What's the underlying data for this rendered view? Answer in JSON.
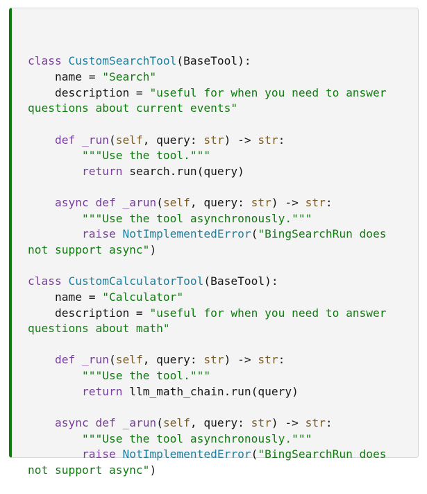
{
  "code": {
    "lines": [
      [
        {
          "t": "kw",
          "v": "class "
        },
        {
          "t": "cls",
          "v": "CustomSearchTool"
        },
        {
          "t": "plain",
          "v": "(BaseTool):"
        }
      ],
      [
        {
          "t": "plain",
          "v": "    name = "
        },
        {
          "t": "str",
          "v": "\"Search\""
        }
      ],
      [
        {
          "t": "plain",
          "v": "    description = "
        },
        {
          "t": "str",
          "v": "\"useful for when you need to answer"
        }
      ],
      [
        {
          "t": "str",
          "v": "questions about current events\""
        }
      ],
      [],
      [
        {
          "t": "plain",
          "v": "    "
        },
        {
          "t": "kw",
          "v": "def "
        },
        {
          "t": "fn",
          "v": "_run"
        },
        {
          "t": "plain",
          "v": "("
        },
        {
          "t": "bi",
          "v": "self"
        },
        {
          "t": "plain",
          "v": ", query: "
        },
        {
          "t": "bi",
          "v": "str"
        },
        {
          "t": "plain",
          "v": ") -> "
        },
        {
          "t": "bi",
          "v": "str"
        },
        {
          "t": "plain",
          "v": ":"
        }
      ],
      [
        {
          "t": "plain",
          "v": "        "
        },
        {
          "t": "str",
          "v": "\"\"\"Use the tool.\"\"\""
        }
      ],
      [
        {
          "t": "plain",
          "v": "        "
        },
        {
          "t": "kw",
          "v": "return "
        },
        {
          "t": "plain",
          "v": "search.run(query)"
        }
      ],
      [],
      [
        {
          "t": "plain",
          "v": "    "
        },
        {
          "t": "kw",
          "v": "async def "
        },
        {
          "t": "fn",
          "v": "_arun"
        },
        {
          "t": "plain",
          "v": "("
        },
        {
          "t": "bi",
          "v": "self"
        },
        {
          "t": "plain",
          "v": ", query: "
        },
        {
          "t": "bi",
          "v": "str"
        },
        {
          "t": "plain",
          "v": ") -> "
        },
        {
          "t": "bi",
          "v": "str"
        },
        {
          "t": "plain",
          "v": ":"
        }
      ],
      [
        {
          "t": "plain",
          "v": "        "
        },
        {
          "t": "str",
          "v": "\"\"\"Use the tool asynchronously.\"\"\""
        }
      ],
      [
        {
          "t": "plain",
          "v": "        "
        },
        {
          "t": "kw",
          "v": "raise "
        },
        {
          "t": "cls",
          "v": "NotImplementedError"
        },
        {
          "t": "plain",
          "v": "("
        },
        {
          "t": "str",
          "v": "\"BingSearchRun does"
        }
      ],
      [
        {
          "t": "str",
          "v": "not support async\""
        },
        {
          "t": "plain",
          "v": ")"
        }
      ],
      [],
      [
        {
          "t": "kw",
          "v": "class "
        },
        {
          "t": "cls",
          "v": "CustomCalculatorTool"
        },
        {
          "t": "plain",
          "v": "(BaseTool):"
        }
      ],
      [
        {
          "t": "plain",
          "v": "    name = "
        },
        {
          "t": "str",
          "v": "\"Calculator\""
        }
      ],
      [
        {
          "t": "plain",
          "v": "    description = "
        },
        {
          "t": "str",
          "v": "\"useful for when you need to answer"
        }
      ],
      [
        {
          "t": "str",
          "v": "questions about math\""
        }
      ],
      [],
      [
        {
          "t": "plain",
          "v": "    "
        },
        {
          "t": "kw",
          "v": "def "
        },
        {
          "t": "fn",
          "v": "_run"
        },
        {
          "t": "plain",
          "v": "("
        },
        {
          "t": "bi",
          "v": "self"
        },
        {
          "t": "plain",
          "v": ", query: "
        },
        {
          "t": "bi",
          "v": "str"
        },
        {
          "t": "plain",
          "v": ") -> "
        },
        {
          "t": "bi",
          "v": "str"
        },
        {
          "t": "plain",
          "v": ":"
        }
      ],
      [
        {
          "t": "plain",
          "v": "        "
        },
        {
          "t": "str",
          "v": "\"\"\"Use the tool.\"\"\""
        }
      ],
      [
        {
          "t": "plain",
          "v": "        "
        },
        {
          "t": "kw",
          "v": "return "
        },
        {
          "t": "plain",
          "v": "llm_math_chain.run(query)"
        }
      ],
      [],
      [
        {
          "t": "plain",
          "v": "    "
        },
        {
          "t": "kw",
          "v": "async def "
        },
        {
          "t": "fn",
          "v": "_arun"
        },
        {
          "t": "plain",
          "v": "("
        },
        {
          "t": "bi",
          "v": "self"
        },
        {
          "t": "plain",
          "v": ", query: "
        },
        {
          "t": "bi",
          "v": "str"
        },
        {
          "t": "plain",
          "v": ") -> "
        },
        {
          "t": "bi",
          "v": "str"
        },
        {
          "t": "plain",
          "v": ":"
        }
      ],
      [
        {
          "t": "plain",
          "v": "        "
        },
        {
          "t": "str",
          "v": "\"\"\"Use the tool asynchronously.\"\"\""
        }
      ],
      [
        {
          "t": "plain",
          "v": "        "
        },
        {
          "t": "kw",
          "v": "raise "
        },
        {
          "t": "cls",
          "v": "NotImplementedError"
        },
        {
          "t": "plain",
          "v": "("
        },
        {
          "t": "str",
          "v": "\"BingSearchRun does"
        }
      ],
      [
        {
          "t": "str",
          "v": "not support async\""
        },
        {
          "t": "plain",
          "v": ")"
        }
      ]
    ]
  },
  "colors": {
    "background": "#f4f4f4",
    "accent_border": "#107c10",
    "keyword": "#7a3e9d",
    "class_name": "#1e7e9e",
    "string": "#107c10",
    "builtin": "#7a5e2a",
    "text": "#171717"
  }
}
